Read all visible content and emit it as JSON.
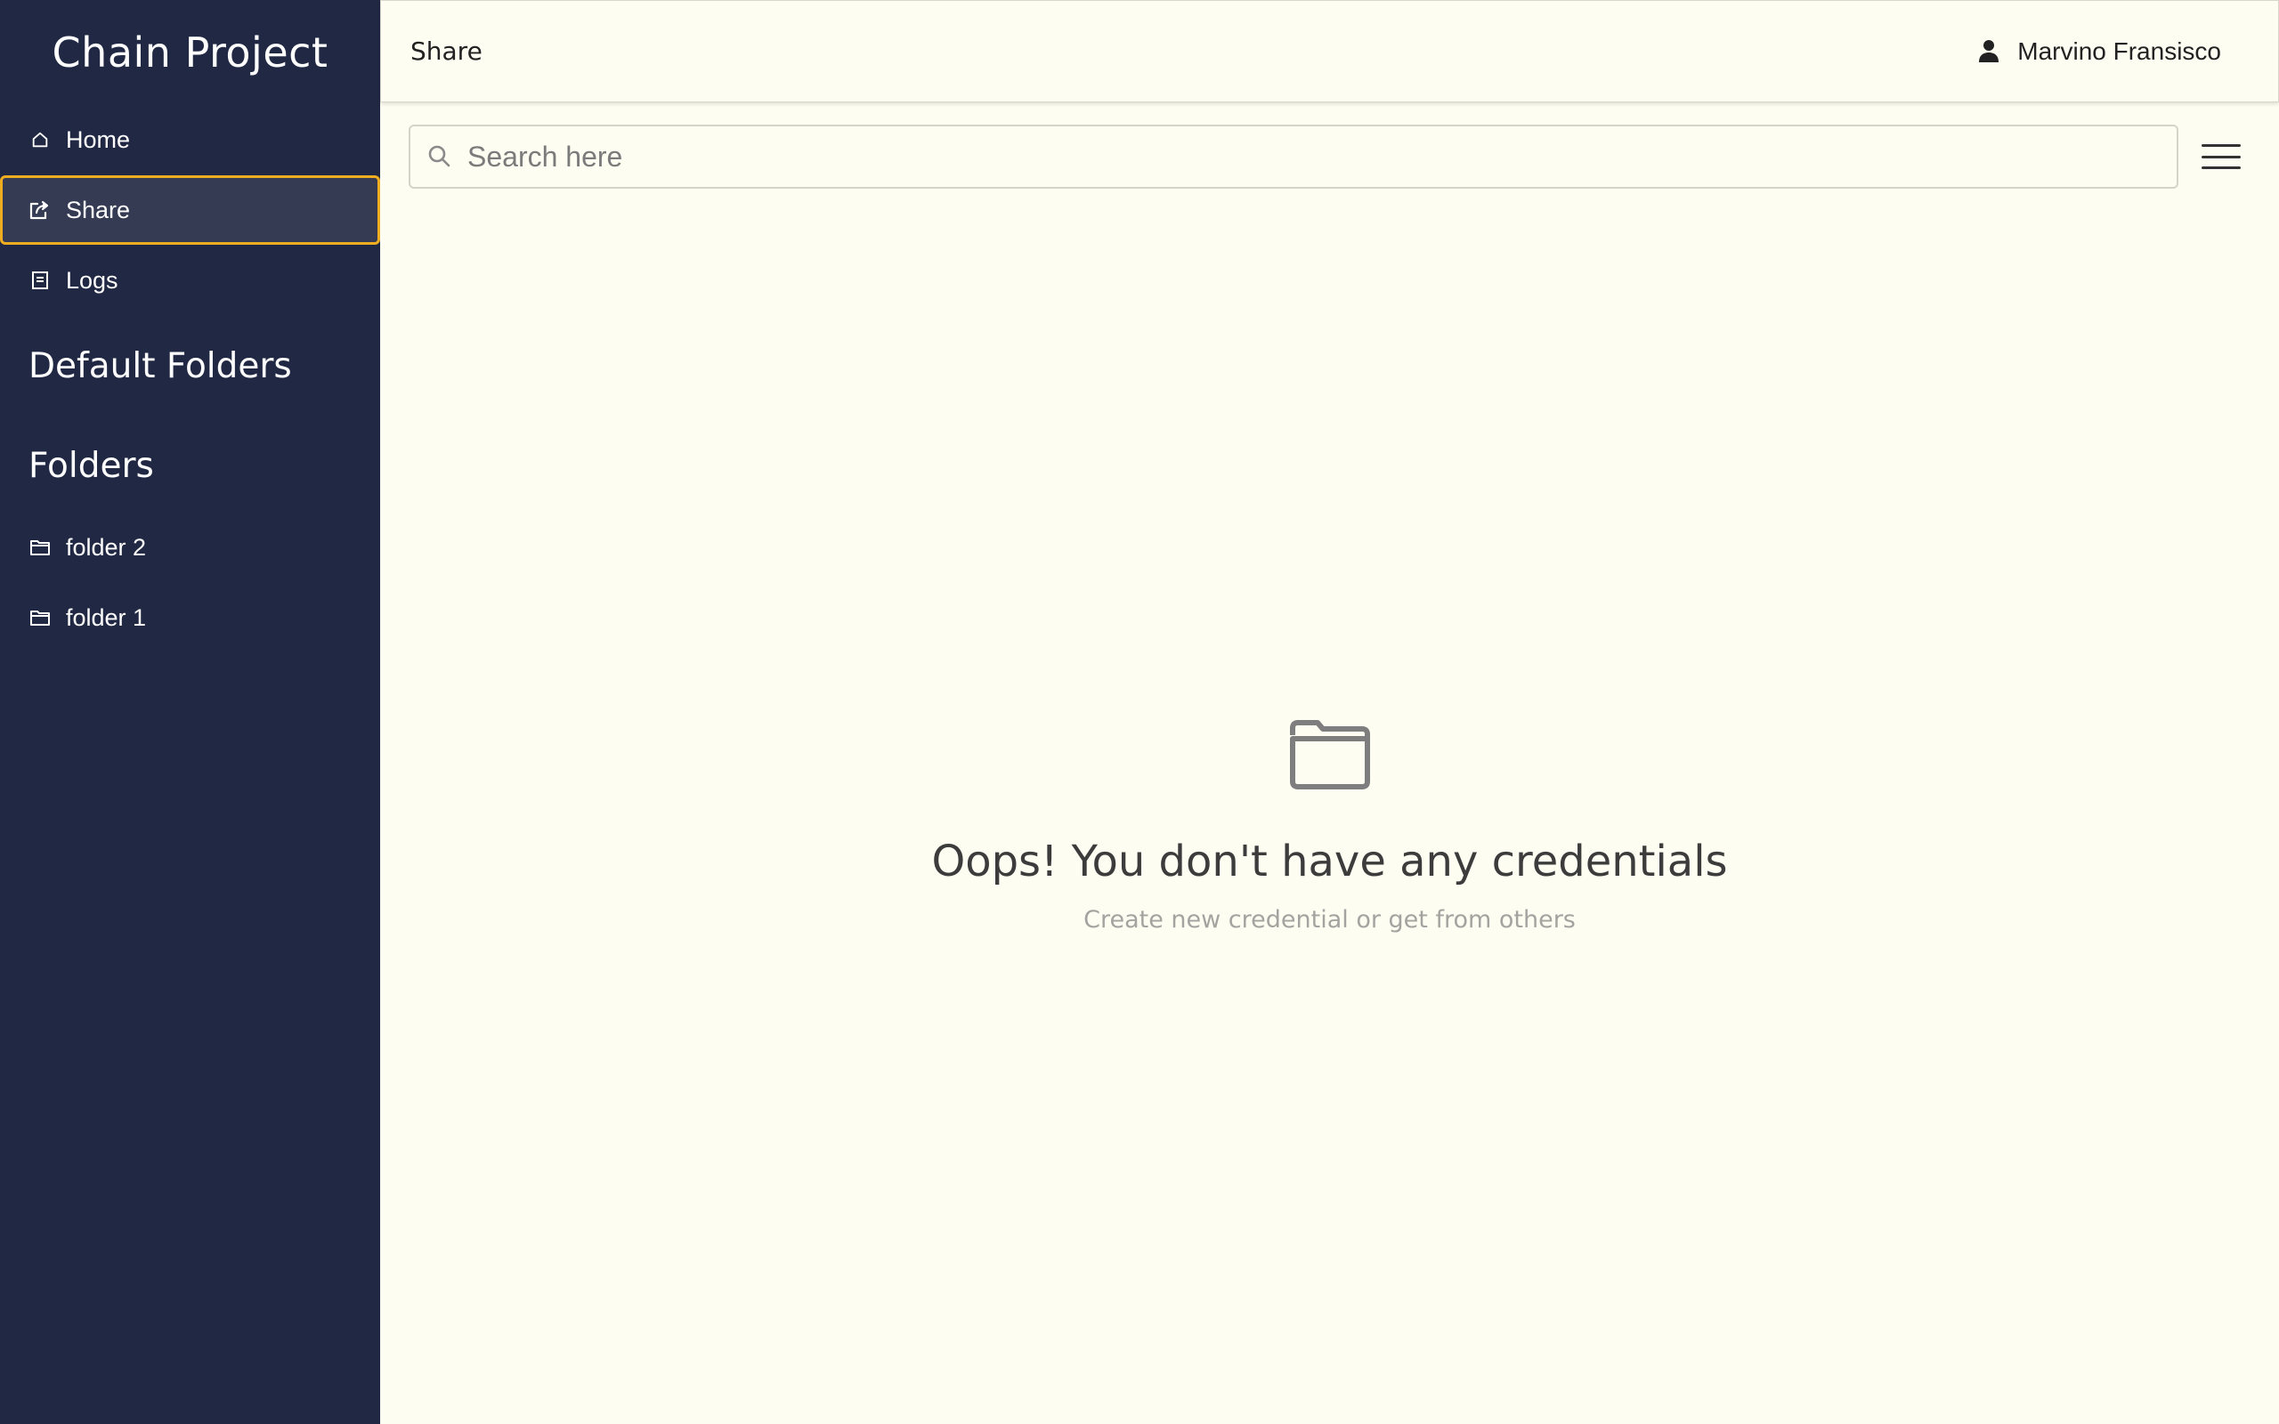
{
  "sidebar": {
    "brand": "Chain Project",
    "nav": [
      {
        "label": "Home",
        "icon": "home-icon"
      },
      {
        "label": "Share",
        "icon": "share-icon",
        "active": true
      },
      {
        "label": "Logs",
        "icon": "logs-icon"
      }
    ],
    "default_folders_title": "Default Folders",
    "folders_title": "Folders",
    "folders": [
      {
        "label": "folder 2",
        "icon": "folder-icon"
      },
      {
        "label": "folder 1",
        "icon": "folder-icon"
      }
    ]
  },
  "header": {
    "title": "Share",
    "user_name": "Marvino Fransisco",
    "user_icon": "user-icon"
  },
  "search": {
    "placeholder": "Search here",
    "value": "",
    "icon": "search-icon"
  },
  "menu": {
    "icon": "hamburger-menu-icon"
  },
  "empty_state": {
    "icon": "open-folder-icon",
    "title": "Oops! You don't have any credentials",
    "subtitle": "Create new credential or get from others"
  },
  "colors": {
    "sidebar_bg": "#212843",
    "active_border": "#f0ad1f",
    "active_bg": "#353b53",
    "main_bg": "#fefdf1"
  }
}
